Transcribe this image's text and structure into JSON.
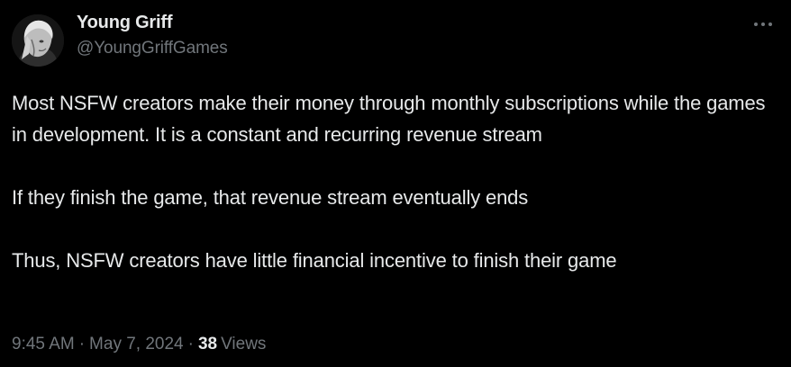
{
  "author": {
    "display_name": "Young Griff",
    "handle": "@YoungGriffGames",
    "avatar_icon": "profile-photo"
  },
  "more_icon": "more-dots-icon",
  "tweet": {
    "paragraphs": [
      "Most NSFW creators make their money through monthly subscriptions while the games in development. It is a constant and recurring revenue stream",
      "If they finish the game, that revenue stream eventually ends",
      "Thus, NSFW creators have little financial incentive to finish their game"
    ]
  },
  "meta": {
    "time": "9:45 AM",
    "separator": "·",
    "date": "May 7, 2024",
    "views_count": "38",
    "views_label": "Views"
  },
  "colors": {
    "background": "#000000",
    "primary_text": "#e7e9ea",
    "secondary_text": "#71767b"
  }
}
